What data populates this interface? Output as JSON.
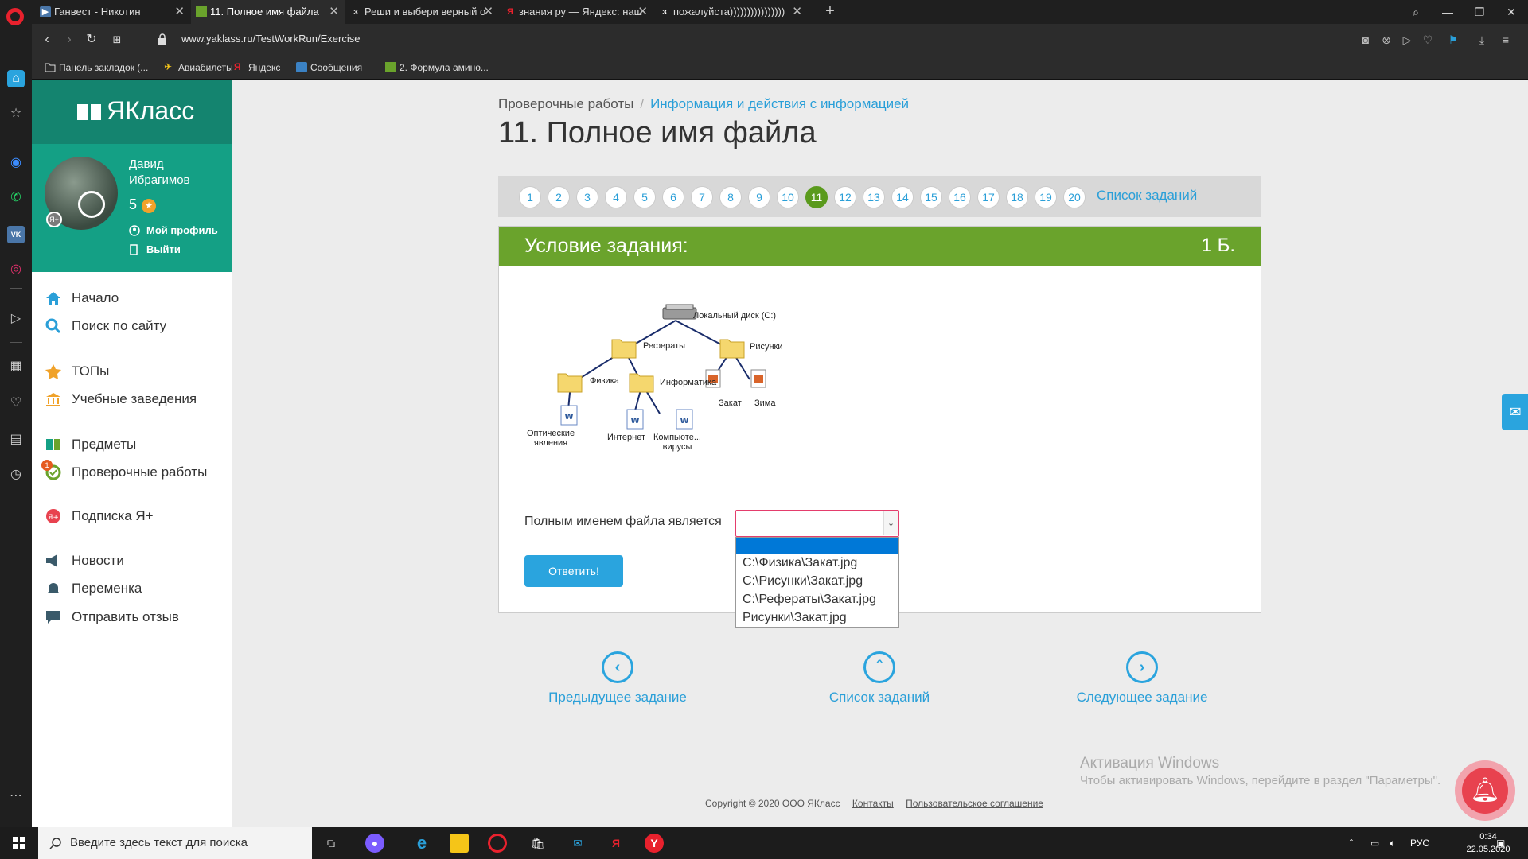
{
  "browser": {
    "tabs": [
      {
        "label": "Ганвест - Никотин",
        "favicon": "vk-video-icon"
      },
      {
        "label": "11. Полное имя файла",
        "favicon": "yaklass-icon"
      },
      {
        "label": "Реши и выбери верный о",
        "favicon": "znanija-icon"
      },
      {
        "label": "знания ру — Яндекс: наш",
        "favicon": "yandex-icon"
      },
      {
        "label": "пожалуйста))))))))))))))))",
        "favicon": "znanija-icon"
      }
    ],
    "url": "www.yaklass.ru/TestWorkRun/Exercise",
    "bookmarks": [
      "Панель закладок (...",
      "Авиабилеты",
      "Яндекс",
      "Сообщения",
      "2. Формула амино..."
    ]
  },
  "sidebar": {
    "logo": "ЯКласс",
    "user_name": "Давид Ибрагимов",
    "score": "5",
    "profile_link": "Мой профиль",
    "logout_link": "Выйти",
    "menu": [
      {
        "label": "Начало"
      },
      {
        "label": "Поиск по сайту"
      },
      {
        "label": "ТОПы"
      },
      {
        "label": "Учебные заведения"
      },
      {
        "label": "Предметы"
      },
      {
        "label": "Проверочные работы",
        "badge": "1"
      },
      {
        "label": "Подписка Я+"
      },
      {
        "label": "Новости"
      },
      {
        "label": "Переменка"
      },
      {
        "label": "Отправить отзыв"
      }
    ]
  },
  "breadcrumb": {
    "first": "Проверочные работы",
    "second": "Информация и действия с информацией"
  },
  "page_title": "11. Полное имя файла",
  "pager": {
    "pages": [
      "1",
      "2",
      "3",
      "4",
      "5",
      "6",
      "7",
      "8",
      "9",
      "10",
      "11",
      "12",
      "13",
      "14",
      "15",
      "16",
      "17",
      "18",
      "19",
      "20"
    ],
    "active": "11",
    "list_link": "Список заданий"
  },
  "task": {
    "header": "Условие задания:",
    "score": "1 Б.",
    "tree": {
      "root": "Локальный диск (C:)",
      "referaty": "Рефераты",
      "risunki": "Рисунки",
      "fizika": "Физика",
      "informatika": "Информатика",
      "zakat": "Закат",
      "zima": "Зима",
      "optic": "Оптические явления",
      "internet": "Интернет",
      "virusy": "Компьюте... вирусы"
    },
    "answer_label": "Полным именем файла является",
    "options": [
      "",
      "C:\\Физика\\Закат.jpg",
      "C:\\Рисунки\\Закат.jpg",
      "C:\\Рефераты\\Закат.jpg",
      "Рисунки\\Закат.jpg"
    ],
    "submit": "Ответить!"
  },
  "nav": {
    "prev": "Предыдущее задание",
    "list": "Список заданий",
    "next": "Следующее задание"
  },
  "footer": {
    "copyright": "Copyright © 2020 ООО ЯКласс",
    "contacts": "Контакты",
    "agreement": "Пользовательское соглашение"
  },
  "watermark": {
    "line1": "Активация Windows",
    "line2": "Чтобы активировать Windows, перейдите в раздел \"Параметры\"."
  },
  "taskbar": {
    "search_placeholder": "Введите здесь текст для поиска",
    "lang": "РУС",
    "time": "0:34",
    "date": "22.05.2020"
  },
  "colors": {
    "accent_green": "#6aa32c",
    "brand_teal": "#14a085",
    "link_blue": "#2a9fd8",
    "active_page": "#5a9a1c"
  }
}
